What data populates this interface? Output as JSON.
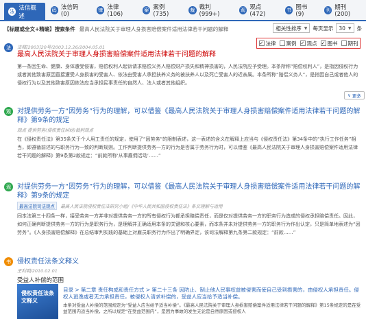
{
  "tabs": [
    {
      "label": "法信概述",
      "icon": "法"
    },
    {
      "label": "法信码 (0)",
      "icon": "码"
    },
    {
      "label": "法律(106)",
      "icon": "律"
    },
    {
      "label": "案例(735)",
      "icon": "案"
    },
    {
      "label": "裁判(999+)",
      "icon": "裁"
    },
    {
      "label": "观点(472)",
      "icon": "观"
    },
    {
      "label": "图书(9)",
      "icon": "书"
    },
    {
      "label": "期刊(200)",
      "icon": "刊"
    }
  ],
  "search": {
    "prefix": "【标题或全文+精确】搜索条件",
    "query": "最高人民法院关于审理人身损害赔偿案件适用法律若干问题的解释",
    "sort_label": "相关性排序",
    "per_page_label": "每页显示",
    "per_page_value": "30",
    "per_page_unit": "条"
  },
  "filters": [
    {
      "label": "法律",
      "checked": true
    },
    {
      "label": "案例",
      "checked": false
    },
    {
      "label": "观点",
      "checked": true
    },
    {
      "label": "图书",
      "checked": true
    },
    {
      "label": "期刊",
      "checked": false
    }
  ],
  "results": [
    {
      "meta": "法释[2003]20号/2003.12.26/2004.05.01",
      "title": "最高人民法院关于审理人身损害赔偿案件适用法律若干问题的解释",
      "body": "第一条因生命、健康、身体遭受侵害，赔偿权利人起诉请求赔偿义务人赔偿财产损失和精神损害的，人民法院应予受理。本条所称“赔偿权利人”，是指因侵权行为或者其他致害原因直接遭受人身损害的受害人、依法由受害人承担扶养义务的被扶养人以及死亡受害人的近亲属。本条所称“赔偿义务人”，是指因自己或者他人的侵权行为以及其他致害原因依法应当承担民事责任的自然人、法人或者其他组织。",
      "more": "更多"
    },
    {
      "title": "对提供劳务一方“因劳务”行为的理解，可以借鉴《最高人民法院关于审理人身损害赔偿案件适用法律若干问题的解释》第9条的规定",
      "meta": "观点  提供劳务(侵权责任纠纷)裁判观点",
      "body": "在《侵权责任法》第35条关于个人用工责任的规定，使用了“因劳务”的限制表述，这一表述的含义在解释上应当与《侵权责任法》第34条中的“执行工作任务”相当，即遵循前述的与职务行为一致的判断规则。工作判断提供劳务一方的行为是否属于劳务行为时，可以借鉴《最高人民法院关于审理人身损害赔偿案件适用法律若干问题的解释》第9条第2款规定：“前款所称‘从事雇佣活动’……”"
    },
    {
      "title": "对提供劳务一方“因劳务”行为的理解，可以借鉴《最高人民法院关于审理人身损害赔偿案件适用法律若干问题的解释》第9条的规定",
      "tag": "最高法院司法观点",
      "meta": "最高人民法院侵权责任法研究小组/《中华人民共和国侵权责任法》条文理解与适用",
      "body": "同本法第三十四条一样，接受劳务一方并非对提供劳务一方的所有侵权行为都承担赔偿责任，而是仅对提供劳务一方的职务行为造成的侵权承担赔偿责任。因此，如何正确判断提供劳务一方的行为是职务行为，是理解并正确适用本条的关键和核心要素，而本条并未对提供劳务一方的职务行为作出认定，只是简单地表述为“因劳务”。《人身损害赔偿解释》在总结审判实践的基础上对雇员职务行为作出了明确界定，该司法解释第九条第二款规定：“前款……”"
    },
    {
      "title": "侵权责任法条文释义",
      "meta": "王利明/2010.02.01",
      "sub": "受益人补偿的范围",
      "book_cover": "侵权责任法条文释义",
      "line1": "目录 > 第二章 责任构成和责任方式 > 第二十三条 因防止、制止他人民事权益被侵害而使自己受到损害的，由侵权人承担责任。侵权人逃逸或者无力承担责任，被侵权人请求补偿的，受益人应当给予适当补偿。",
      "line2": "本条对受益人补偿的范围规定为“受益人应当给予适当补偿”。《最高人民法院关于审理人身损害赔偿案件适用法律若干问题的解释》第15条规定的是在受益范围内适当补偿，之所以规定“在受益范围内”，是因为事故的发生无论是自然原因或侵权人"
    }
  ],
  "colors": {
    "accent": "#2e67b8",
    "red": "#cc0000",
    "green": "#2fa84f",
    "orange": "#f08c00"
  }
}
